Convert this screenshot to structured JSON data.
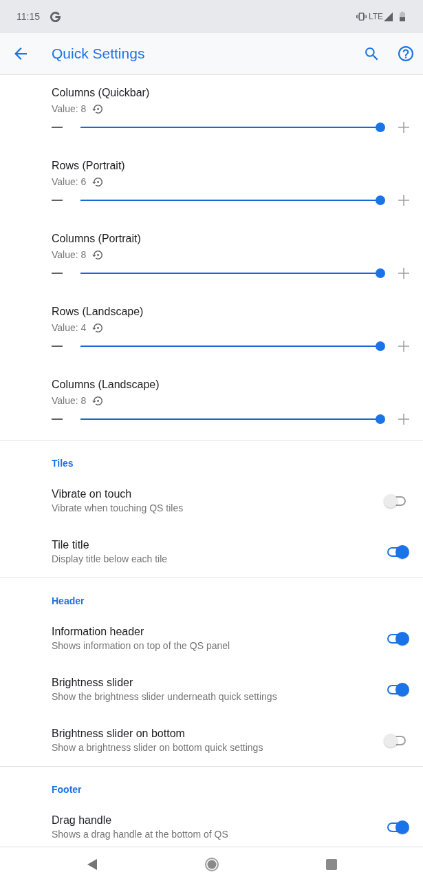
{
  "status_bar": {
    "time": "11:15",
    "network": "LTE"
  },
  "app_bar": {
    "title": "Quick Settings"
  },
  "sliders": [
    {
      "title": "Columns (Quickbar)",
      "value": "Value: 8",
      "level": 1
    },
    {
      "title": "Rows (Portrait)",
      "value": "Value: 6",
      "level": 1
    },
    {
      "title": "Columns (Portrait)",
      "value": "Value: 8",
      "level": 1
    },
    {
      "title": "Rows (Landscape)",
      "value": "Value: 4",
      "level": 1
    },
    {
      "title": "Columns (Landscape)",
      "value": "Value: 8",
      "level": 1
    }
  ],
  "sections": [
    {
      "title": "Tiles",
      "items": [
        {
          "title": "Vibrate on touch",
          "summary": "Vibrate when touching QS tiles",
          "on": false
        },
        {
          "title": "Tile title",
          "summary": "Display title below each tile",
          "on": true
        }
      ]
    },
    {
      "title": "Header",
      "items": [
        {
          "title": "Information header",
          "summary": "Shows information on top of the QS panel",
          "on": true
        },
        {
          "title": "Brightness slider",
          "summary": "Show the brightness slider underneath quick settings",
          "on": true
        },
        {
          "title": "Brightness slider on bottom",
          "summary": "Show a brightness slider on bottom quick settings",
          "on": false
        }
      ]
    },
    {
      "title": "Footer",
      "items": [
        {
          "title": "Drag handle",
          "summary": "Shows a drag handle at the bottom of QS",
          "on": true
        }
      ]
    }
  ]
}
